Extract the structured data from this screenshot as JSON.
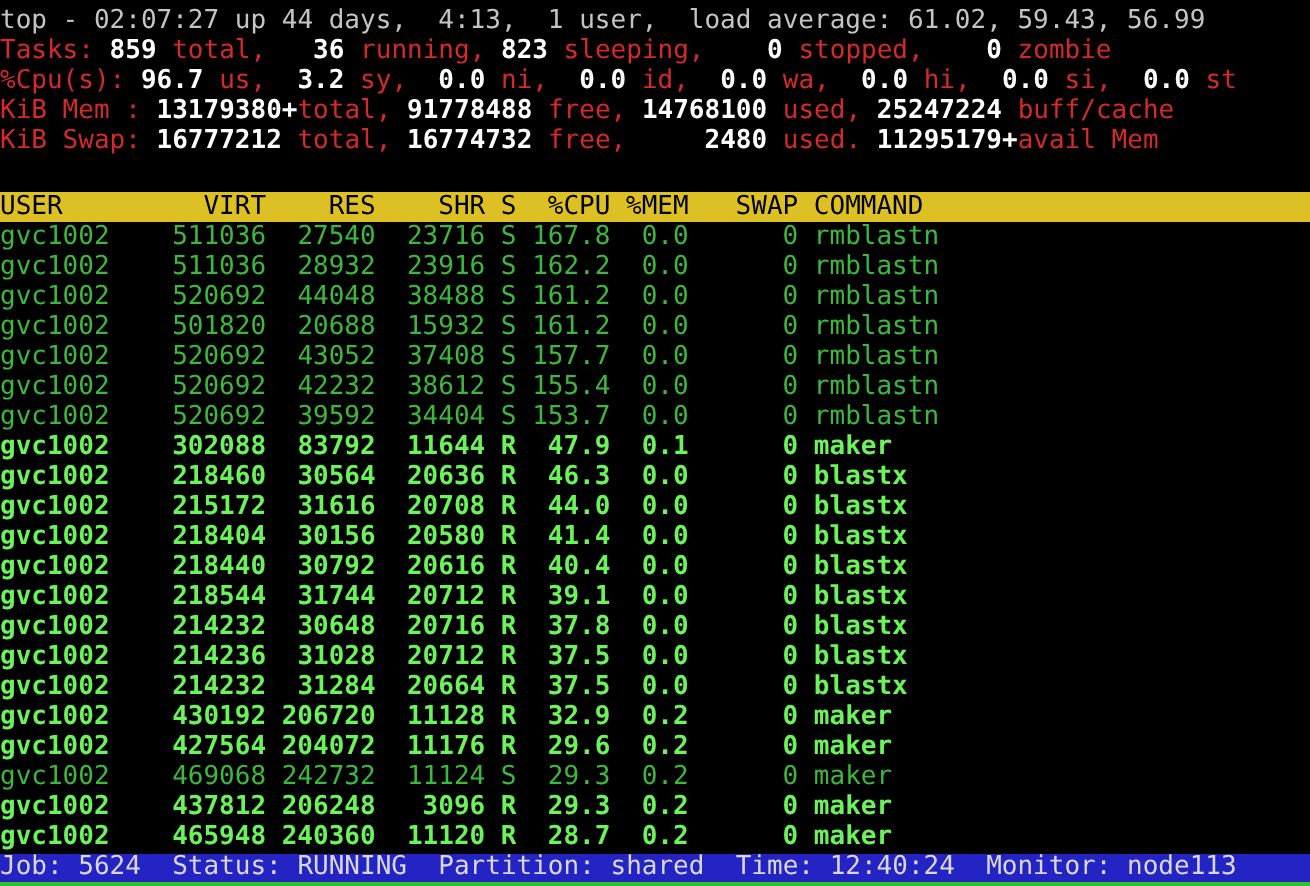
{
  "summary": [
    [
      {
        "kind": "plain",
        "text": "top - 02:07:27 up 44 days,  4:13,  1 user,  load average: 61.02, 59.43, 56.99"
      }
    ],
    [
      {
        "kind": "label",
        "text": "Tasks:"
      },
      {
        "kind": "value",
        "text": " 859"
      },
      {
        "kind": "label",
        "text": " total,  "
      },
      {
        "kind": "value",
        "text": " 36"
      },
      {
        "kind": "label",
        "text": " running,"
      },
      {
        "kind": "value",
        "text": " 823"
      },
      {
        "kind": "label",
        "text": " sleeping,  "
      },
      {
        "kind": "value",
        "text": "  0"
      },
      {
        "kind": "label",
        "text": " stopped,  "
      },
      {
        "kind": "value",
        "text": "  0"
      },
      {
        "kind": "label",
        "text": " zombie"
      }
    ],
    [
      {
        "kind": "label",
        "text": "%Cpu(s):"
      },
      {
        "kind": "value",
        "text": " 96.7"
      },
      {
        "kind": "label",
        "text": " us, "
      },
      {
        "kind": "value",
        "text": " 3.2"
      },
      {
        "kind": "label",
        "text": " sy, "
      },
      {
        "kind": "value",
        "text": " 0.0"
      },
      {
        "kind": "label",
        "text": " ni, "
      },
      {
        "kind": "value",
        "text": " 0.0"
      },
      {
        "kind": "label",
        "text": " id, "
      },
      {
        "kind": "value",
        "text": " 0.0"
      },
      {
        "kind": "label",
        "text": " wa, "
      },
      {
        "kind": "value",
        "text": " 0.0"
      },
      {
        "kind": "label",
        "text": " hi, "
      },
      {
        "kind": "value",
        "text": " 0.0"
      },
      {
        "kind": "label",
        "text": " si, "
      },
      {
        "kind": "value",
        "text": " 0.0"
      },
      {
        "kind": "label",
        "text": " st"
      }
    ],
    [
      {
        "kind": "label",
        "text": "KiB Mem :"
      },
      {
        "kind": "value",
        "text": " 13179380+"
      },
      {
        "kind": "label",
        "text": "total,"
      },
      {
        "kind": "value",
        "text": " 91778488"
      },
      {
        "kind": "label",
        "text": " free,"
      },
      {
        "kind": "value",
        "text": " 14768100"
      },
      {
        "kind": "label",
        "text": " used,"
      },
      {
        "kind": "value",
        "text": " 25247224"
      },
      {
        "kind": "label",
        "text": " buff/cache"
      }
    ],
    [
      {
        "kind": "label",
        "text": "KiB Swap:"
      },
      {
        "kind": "value",
        "text": " 16777212"
      },
      {
        "kind": "label",
        "text": " total,"
      },
      {
        "kind": "value",
        "text": " 16774732"
      },
      {
        "kind": "label",
        "text": " free,"
      },
      {
        "kind": "value",
        "text": "     2480"
      },
      {
        "kind": "label",
        "text": " used."
      },
      {
        "kind": "value",
        "text": " 11295179+"
      },
      {
        "kind": "label",
        "text": "avail Mem"
      }
    ]
  ],
  "table": {
    "columns": [
      "USER",
      "VIRT",
      "RES",
      "SHR",
      "S",
      "%CPU",
      "%MEM",
      "SWAP",
      "COMMAND"
    ],
    "rows": [
      {
        "highlighted": false,
        "cells": [
          "gvc1002",
          "511036",
          "27540",
          "23716",
          "S",
          "167.8",
          "0.0",
          "0",
          "rmblastn"
        ]
      },
      {
        "highlighted": false,
        "cells": [
          "gvc1002",
          "511036",
          "28932",
          "23916",
          "S",
          "162.2",
          "0.0",
          "0",
          "rmblastn"
        ]
      },
      {
        "highlighted": false,
        "cells": [
          "gvc1002",
          "520692",
          "44048",
          "38488",
          "S",
          "161.2",
          "0.0",
          "0",
          "rmblastn"
        ]
      },
      {
        "highlighted": false,
        "cells": [
          "gvc1002",
          "501820",
          "20688",
          "15932",
          "S",
          "161.2",
          "0.0",
          "0",
          "rmblastn"
        ]
      },
      {
        "highlighted": false,
        "cells": [
          "gvc1002",
          "520692",
          "43052",
          "37408",
          "S",
          "157.7",
          "0.0",
          "0",
          "rmblastn"
        ]
      },
      {
        "highlighted": false,
        "cells": [
          "gvc1002",
          "520692",
          "42232",
          "38612",
          "S",
          "155.4",
          "0.0",
          "0",
          "rmblastn"
        ]
      },
      {
        "highlighted": false,
        "cells": [
          "gvc1002",
          "520692",
          "39592",
          "34404",
          "S",
          "153.7",
          "0.0",
          "0",
          "rmblastn"
        ]
      },
      {
        "highlighted": true,
        "cells": [
          "gvc1002",
          "302088",
          "83792",
          "11644",
          "R",
          "47.9",
          "0.1",
          "0",
          "maker"
        ]
      },
      {
        "highlighted": true,
        "cells": [
          "gvc1002",
          "218460",
          "30564",
          "20636",
          "R",
          "46.3",
          "0.0",
          "0",
          "blastx"
        ]
      },
      {
        "highlighted": true,
        "cells": [
          "gvc1002",
          "215172",
          "31616",
          "20708",
          "R",
          "44.0",
          "0.0",
          "0",
          "blastx"
        ]
      },
      {
        "highlighted": true,
        "cells": [
          "gvc1002",
          "218404",
          "30156",
          "20580",
          "R",
          "41.4",
          "0.0",
          "0",
          "blastx"
        ]
      },
      {
        "highlighted": true,
        "cells": [
          "gvc1002",
          "218440",
          "30792",
          "20616",
          "R",
          "40.4",
          "0.0",
          "0",
          "blastx"
        ]
      },
      {
        "highlighted": true,
        "cells": [
          "gvc1002",
          "218544",
          "31744",
          "20712",
          "R",
          "39.1",
          "0.0",
          "0",
          "blastx"
        ]
      },
      {
        "highlighted": true,
        "cells": [
          "gvc1002",
          "214232",
          "30648",
          "20716",
          "R",
          "37.8",
          "0.0",
          "0",
          "blastx"
        ]
      },
      {
        "highlighted": true,
        "cells": [
          "gvc1002",
          "214236",
          "31028",
          "20712",
          "R",
          "37.5",
          "0.0",
          "0",
          "blastx"
        ]
      },
      {
        "highlighted": true,
        "cells": [
          "gvc1002",
          "214232",
          "31284",
          "20664",
          "R",
          "37.5",
          "0.0",
          "0",
          "blastx"
        ]
      },
      {
        "highlighted": true,
        "cells": [
          "gvc1002",
          "430192",
          "206720",
          "11128",
          "R",
          "32.9",
          "0.2",
          "0",
          "maker"
        ]
      },
      {
        "highlighted": true,
        "cells": [
          "gvc1002",
          "427564",
          "204072",
          "11176",
          "R",
          "29.6",
          "0.2",
          "0",
          "maker"
        ]
      },
      {
        "highlighted": false,
        "cells": [
          "gvc1002",
          "469068",
          "242732",
          "11124",
          "S",
          "29.3",
          "0.2",
          "0",
          "maker"
        ]
      },
      {
        "highlighted": true,
        "cells": [
          "gvc1002",
          "437812",
          "206248",
          "3096",
          "R",
          "29.3",
          "0.2",
          "0",
          "maker"
        ]
      },
      {
        "highlighted": true,
        "cells": [
          "gvc1002",
          "465948",
          "240360",
          "11120",
          "R",
          "28.7",
          "0.2",
          "0",
          "maker"
        ]
      }
    ]
  },
  "status_bar": "Job: 5624  Status: RUNNING  Partition: shared  Time: 12:40:24  Monitor: node113"
}
